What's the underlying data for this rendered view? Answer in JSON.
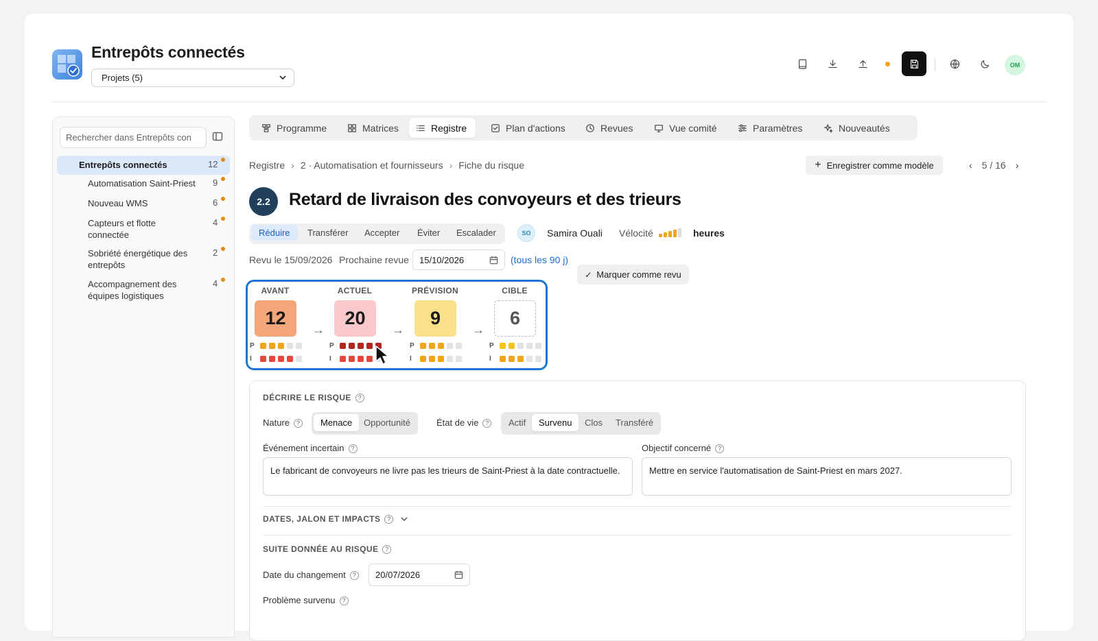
{
  "header": {
    "app_title": "Entrepôts connectés",
    "project_select": "Projets (5)",
    "user_initials": "OM",
    "colors": {
      "accent": "#1c76d2",
      "unsaved_dot": "#f0a51c",
      "avatar_bg": "#d4f5df",
      "avatar_fg": "#22a052"
    }
  },
  "sidebar": {
    "search_placeholder": "Rechercher dans Entrepôts con",
    "root": {
      "label": "Entrepôts connectés",
      "count": "12"
    },
    "items": [
      {
        "label": "Automatisation Saint-Priest",
        "count": "9"
      },
      {
        "label": "Nouveau WMS",
        "count": "6"
      },
      {
        "label": "Capteurs et flotte connectée",
        "count": "4"
      },
      {
        "label": "Sobriété énergétique des entrepôts",
        "count": "2"
      },
      {
        "label": "Accompagnement des équipes logistiques",
        "count": "4"
      }
    ]
  },
  "tabs": [
    "Programme",
    "Matrices",
    "Registre",
    "Plan d'actions",
    "Revues",
    "Vue comité",
    "Paramètres",
    "Nouveautés"
  ],
  "breadcrumb": [
    "Registre",
    "2 · Automatisation et fournisseurs",
    "Fiche du risque"
  ],
  "record": {
    "template_button": "Enregistrer comme modèle",
    "pager": "5 / 16",
    "id_badge": "2.2",
    "title": "Retard de livraison des convoyeurs et des trieurs",
    "strategies": [
      "Réduire",
      "Transférer",
      "Accepter",
      "Éviter",
      "Escalader"
    ],
    "owner_initials": "SO",
    "owner_name": "Samira Ouali",
    "velocity_label": "Vélocité",
    "velocity_value": "heures",
    "velocity_level": 4,
    "reviewed": "Revu le 15/09/2026",
    "next_review_label": "Prochaine revue",
    "next_review_date": "15/10/2026",
    "review_frequency": "(tous les 90 j)",
    "mark_reviewed": "Marquer comme revu"
  },
  "scores": [
    {
      "label": "AVANT",
      "value": "12",
      "bg": "#f2a679",
      "p": 3,
      "i": 4
    },
    {
      "label": "ACTUEL",
      "value": "20",
      "bg": "#f9c8cb",
      "p": 5,
      "i": 4
    },
    {
      "label": "PRÉVISION",
      "value": "9",
      "bg": "#fbe08a",
      "p": 3,
      "i": 3
    },
    {
      "label": "CIBLE",
      "value": "6",
      "bg": "#ffffff",
      "p": 2,
      "i": 3
    }
  ],
  "score_axes": {
    "p": "P",
    "i": "I"
  },
  "form": {
    "describe_title": "DÉCRIRE LE RISQUE",
    "nature_label": "Nature",
    "nature_options": [
      "Menace",
      "Opportunité"
    ],
    "state_label": "État de vie",
    "state_options": [
      "Actif",
      "Survenu",
      "Clos",
      "Transféré"
    ],
    "event_label": "Événement incertain",
    "event_text": "Le fabricant de convoyeurs ne livre pas les trieurs de Saint-Priest à la date contractuelle.",
    "objective_label": "Objectif concerné",
    "objective_text": "Mettre en service l'automatisation de Saint-Priest en mars 2027.",
    "dates_title": "DATES, JALON ET IMPACTS",
    "follow_title": "SUITE DONNÉE AU RISQUE",
    "change_date_label": "Date du changement",
    "change_date": "20/07/2026",
    "problem_label": "Problème survenu"
  }
}
